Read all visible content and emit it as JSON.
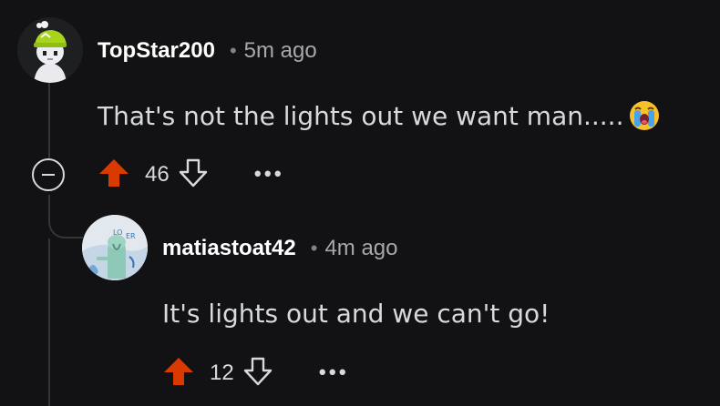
{
  "comments": [
    {
      "username": "TopStar200",
      "separator": "•",
      "time": "5m ago",
      "text": "That's not the lights out we want man.....",
      "emoji_icon": "loudly-crying-face-icon",
      "score": "46",
      "more_label": "•••"
    },
    {
      "username": "matiastoat42",
      "separator": "•",
      "time": "4m ago",
      "text": "It's lights out and we can't go!",
      "score": "12",
      "more_label": "•••"
    }
  ],
  "colors": {
    "background": "#121113",
    "upvote_active": "#d93a00",
    "text": "#d7dadc",
    "meta": "#a6a8aa",
    "thread": "#343536"
  }
}
